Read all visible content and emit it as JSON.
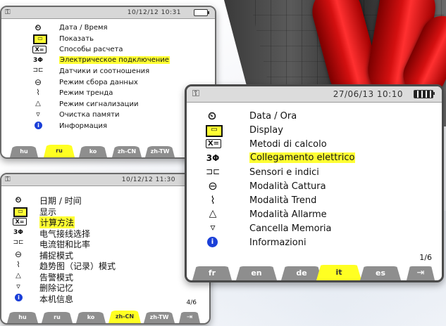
{
  "screens": {
    "russian": {
      "status": {
        "date": "10/12/12 10:31"
      },
      "menu": [
        {
          "icon": "⏲",
          "label": "Дата / Время"
        },
        {
          "icon": "▭",
          "label": "Показать"
        },
        {
          "icon": "X=",
          "label": "Способы расчета"
        },
        {
          "icon": "3Φ",
          "label": "Электрическое подключение"
        },
        {
          "icon": "⊐⊏",
          "label": "Датчики и соотношения"
        },
        {
          "icon": "⊖",
          "label": "Режим сбора данных"
        },
        {
          "icon": "⌇",
          "label": "Режим тренда"
        },
        {
          "icon": "△",
          "label": "Режим сигнализации"
        },
        {
          "icon": "▿",
          "label": "Очистка памяти"
        },
        {
          "icon": "i",
          "label": "Информация"
        }
      ],
      "tabs": [
        "hu",
        "ru",
        "ko",
        "zh-CN",
        "zh-TW"
      ],
      "active_tab": "ru"
    },
    "chinese": {
      "status": {
        "date": "10/12/12 11:30"
      },
      "menu": [
        {
          "icon": "⏲",
          "label": "日期 / 时间"
        },
        {
          "icon": "▭",
          "label": "显示"
        },
        {
          "icon": "X=",
          "label": "计算方法"
        },
        {
          "icon": "3Φ",
          "label": "电气接线选择"
        },
        {
          "icon": "⊐⊏",
          "label": "电流钳和比率"
        },
        {
          "icon": "⊖",
          "label": "捕捉模式"
        },
        {
          "icon": "⌇",
          "label": "趋势图（记录）模式"
        },
        {
          "icon": "△",
          "label": "告警模式"
        },
        {
          "icon": "▿",
          "label": "删除记忆"
        },
        {
          "icon": "i",
          "label": "本机信息"
        }
      ],
      "tabs": [
        "hu",
        "ru",
        "ko",
        "zh-CN",
        "zh-TW"
      ],
      "active_tab": "zh-CN",
      "page": "4/6"
    },
    "italian": {
      "status": {
        "date": "27/06/13 10:10"
      },
      "menu": [
        {
          "icon": "⏲",
          "label": "Data / Ora"
        },
        {
          "icon": "▭",
          "label": "Display"
        },
        {
          "icon": "X=",
          "label": "Metodi di calcolo"
        },
        {
          "icon": "3Φ",
          "label": "Collegamento elettrico"
        },
        {
          "icon": "⊐⊏",
          "label": "Sensori e indici"
        },
        {
          "icon": "⊖",
          "label": "Modalità Cattura"
        },
        {
          "icon": "⌇",
          "label": "Modalità Trend"
        },
        {
          "icon": "△",
          "label": "Modalità Allarme"
        },
        {
          "icon": "▿",
          "label": "Cancella Memoria"
        },
        {
          "icon": "i",
          "label": "Informazioni"
        }
      ],
      "tabs": [
        "fr",
        "en",
        "de",
        "it",
        "es"
      ],
      "active_tab": "it",
      "page": "1/6"
    }
  },
  "icons": {
    "wrench": "⚿",
    "exit": "⇥"
  },
  "colors": {
    "highlight": "#ffff33",
    "tab": "#8e8e8e",
    "info_icon": "#1a3fd8"
  }
}
